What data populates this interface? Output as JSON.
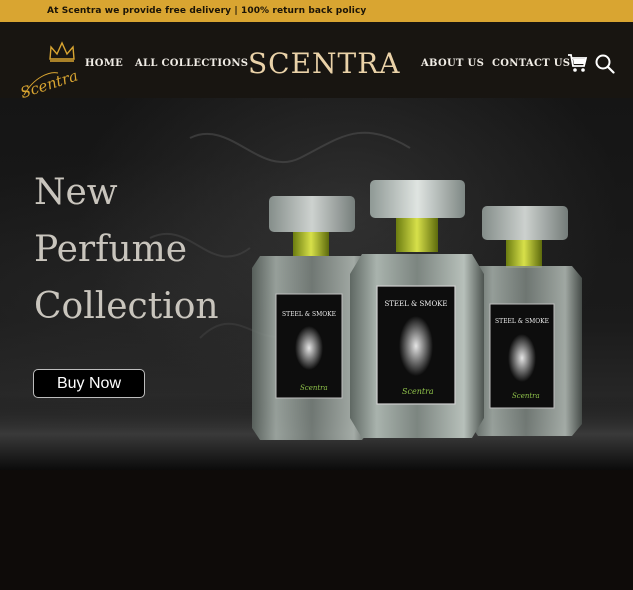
{
  "announcement": "At Scentra we provide free delivery | 100% return back policy",
  "logo_text": "Scentra",
  "nav": {
    "home": "HOME",
    "all_collections": "ALL COLLECTIONS",
    "brand": "SCENTRA",
    "about": "ABOUT US",
    "contact": "CONTACT US"
  },
  "icons": [
    "cart-icon",
    "search-icon",
    "crown-icon"
  ],
  "hero": {
    "title_line1": "New",
    "title_line2": "Perfume",
    "title_line3": "Collection",
    "cta": "Buy Now",
    "bottle_label": "STEEL & SMOKE",
    "bottle_signature": "Scentra"
  },
  "colors": {
    "announcement_bg": "#d9a531",
    "header_bg": "#181511",
    "brand_gold": "#ead2a8",
    "page_bg": "#0e0b09"
  }
}
